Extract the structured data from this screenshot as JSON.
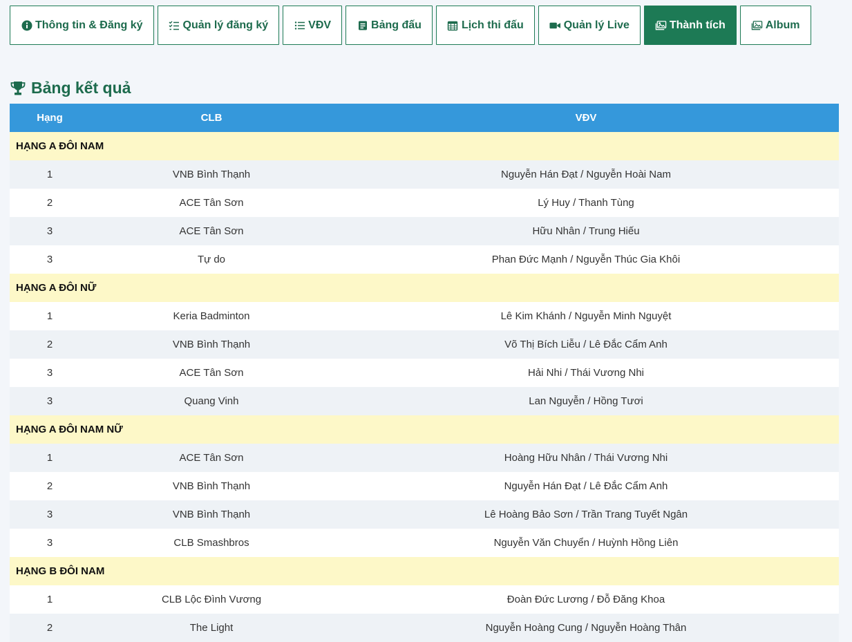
{
  "tabs": [
    {
      "label": "Thông tin & Đăng ký",
      "icon": "info-circle-icon",
      "active": false
    },
    {
      "label": "Quản lý đăng ký",
      "icon": "checklist-icon",
      "active": false
    },
    {
      "label": "VĐV",
      "icon": "list-icon",
      "active": false
    },
    {
      "label": "Bảng đấu",
      "icon": "bracket-icon",
      "active": false
    },
    {
      "label": "Lịch thi đấu",
      "icon": "calendar-icon",
      "active": false
    },
    {
      "label": "Quản lý Live",
      "icon": "video-camera-icon",
      "active": false
    },
    {
      "label": "Thành tích",
      "icon": "images-icon",
      "active": true
    },
    {
      "label": "Album",
      "icon": "image-icon",
      "active": false
    }
  ],
  "results_title": "Bảng kết quả",
  "table": {
    "headers": {
      "rank": "Hạng",
      "club": "CLB",
      "players": "VĐV"
    },
    "groups": [
      {
        "name": "HẠNG A ĐÔI NAM",
        "rows": [
          {
            "rank": "1",
            "club": "VNB Bình Thạnh",
            "players": "Nguyễn Hán Đạt / Nguyễn Hoài Nam"
          },
          {
            "rank": "2",
            "club": "ACE Tân Sơn",
            "players": "Lý Huy / Thanh Tùng"
          },
          {
            "rank": "3",
            "club": "ACE Tân Sơn",
            "players": "Hữu Nhân / Trung Hiếu"
          },
          {
            "rank": "3",
            "club": "Tự do",
            "players": "Phan Đức Mạnh / Nguyễn Thúc Gia Khôi"
          }
        ]
      },
      {
        "name": "HẠNG A ĐÔI NỮ",
        "rows": [
          {
            "rank": "1",
            "club": "Keria Badminton",
            "players": "Lê Kim Khánh / Nguyễn Minh Nguyệt"
          },
          {
            "rank": "2",
            "club": "VNB Bình Thạnh",
            "players": "Võ Thị Bích Liễu / Lê Đắc Cẩm Anh"
          },
          {
            "rank": "3",
            "club": "ACE Tân Sơn",
            "players": "Hải Nhi / Thái Vương Nhi"
          },
          {
            "rank": "3",
            "club": "Quang Vinh",
            "players": "Lan Nguyễn / Hồng Tươi"
          }
        ]
      },
      {
        "name": "HẠNG A ĐÔI NAM NỮ",
        "rows": [
          {
            "rank": "1",
            "club": "ACE Tân Sơn",
            "players": "Hoàng Hữu Nhân / Thái Vương Nhi"
          },
          {
            "rank": "2",
            "club": "VNB Bình Thạnh",
            "players": "Nguyễn Hán Đạt / Lê Đắc Cẩm Anh"
          },
          {
            "rank": "3",
            "club": "VNB Bình Thạnh",
            "players": "Lê Hoàng Bảo Sơn / Trần Trang Tuyết Ngân"
          },
          {
            "rank": "3",
            "club": "CLB Smashbros",
            "players": "Nguyễn Văn Chuyển / Huỳnh Hồng Liên"
          }
        ]
      },
      {
        "name": "HẠNG B ĐÔI NAM",
        "rows": [
          {
            "rank": "1",
            "club": "CLB Lộc Đình Vương",
            "players": "Đoàn Đức Lương / Đỗ Đăng Khoa"
          },
          {
            "rank": "2",
            "club": "The Light",
            "players": "Nguyễn Hoàng Cung / Nguyễn Hoàng Thân"
          }
        ]
      }
    ]
  },
  "colors": {
    "brand_green": "#1d7a55",
    "header_blue": "#3598db",
    "group_row_yellow": "#fdf8c8",
    "stripe_row": "#eef2f6"
  }
}
